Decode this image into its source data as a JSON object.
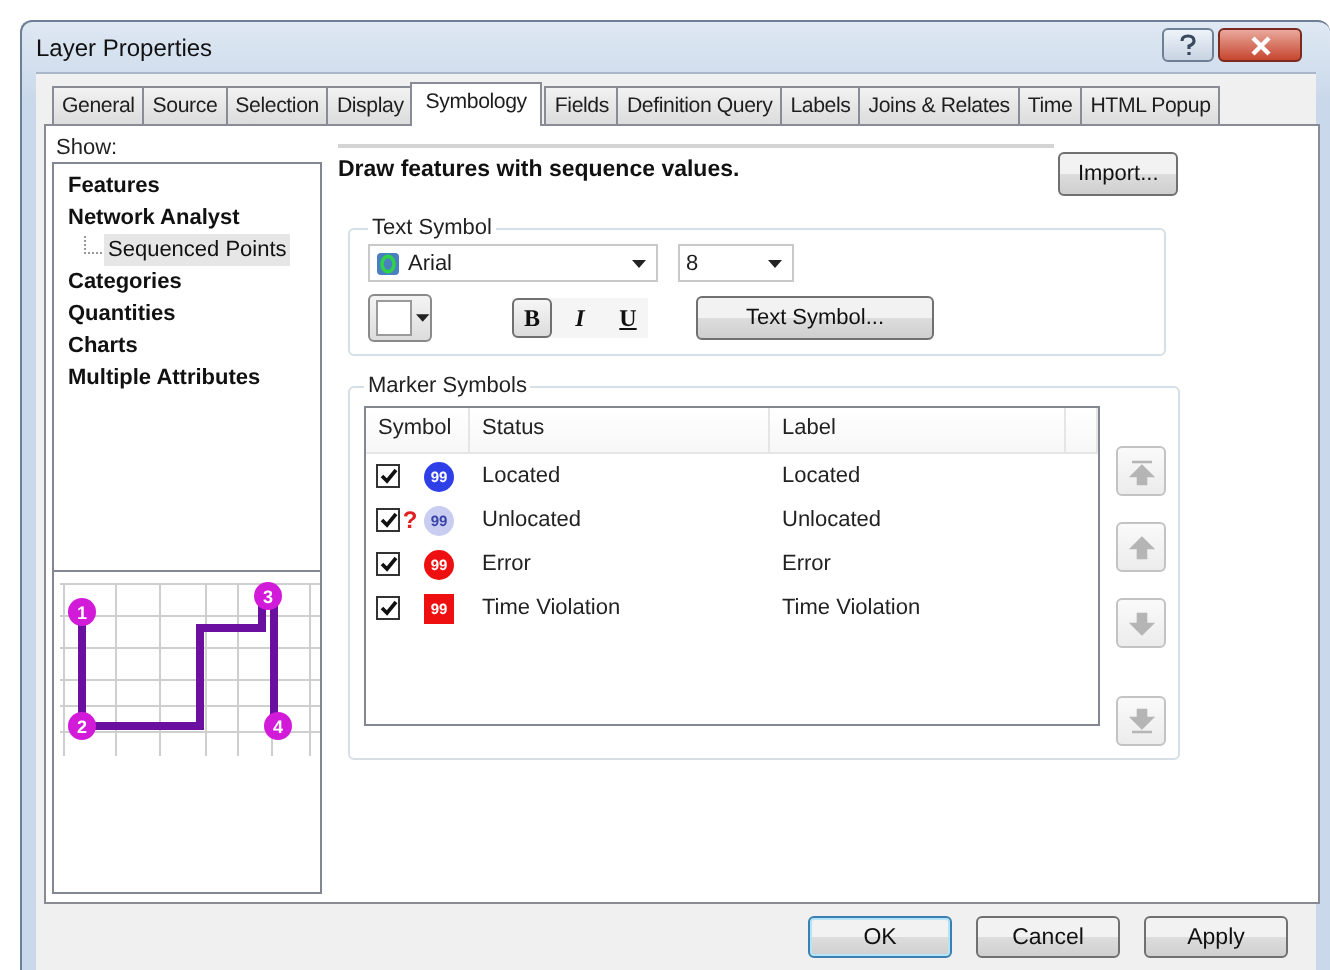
{
  "window": {
    "title": "Layer Properties"
  },
  "tabs": [
    {
      "label": "General",
      "selected": false
    },
    {
      "label": "Source",
      "selected": false
    },
    {
      "label": "Selection",
      "selected": false
    },
    {
      "label": "Display",
      "selected": false
    },
    {
      "label": "Symbology",
      "selected": true
    },
    {
      "label": "Fields",
      "selected": false
    },
    {
      "label": "Definition Query",
      "selected": false
    },
    {
      "label": "Labels",
      "selected": false
    },
    {
      "label": "Joins & Relates",
      "selected": false
    },
    {
      "label": "Time",
      "selected": false
    },
    {
      "label": "HTML Popup",
      "selected": false
    }
  ],
  "show": {
    "label": "Show:",
    "items": [
      {
        "label": "Features",
        "selected": false
      },
      {
        "label": "Network Analyst",
        "selected": false,
        "children": [
          {
            "label": "Sequenced Points",
            "selected": true
          }
        ]
      },
      {
        "label": "Categories",
        "selected": false
      },
      {
        "label": "Quantities",
        "selected": false
      },
      {
        "label": "Charts",
        "selected": false
      },
      {
        "label": "Multiple Attributes",
        "selected": false
      }
    ]
  },
  "preview": {
    "points": [
      "1",
      "2",
      "3",
      "4"
    ]
  },
  "description": "Draw features with sequence values.",
  "import_button": "Import...",
  "text_symbol": {
    "title": "Text Symbol",
    "font": "Arial",
    "size": "8",
    "color": "#ffffff",
    "styles": [
      {
        "label": "B",
        "kind": "bold",
        "selected": true
      },
      {
        "label": "I",
        "kind": "italic",
        "selected": false
      },
      {
        "label": "U",
        "kind": "underline",
        "selected": false
      }
    ],
    "button": "Text Symbol..."
  },
  "marker_symbols": {
    "title": "Marker Symbols",
    "columns": [
      "Symbol",
      "Status",
      "Label"
    ],
    "rows": [
      {
        "checked": true,
        "kind": "circle",
        "color": "#2f3fe8",
        "symbol_text": "99",
        "status": "Located",
        "label": "Located"
      },
      {
        "checked": true,
        "kind": "unlocated",
        "color": "#c9cdf2",
        "symbol_text": "99",
        "marker": "?",
        "status": "Unlocated",
        "label": "Unlocated"
      },
      {
        "checked": true,
        "kind": "circle",
        "color": "#ee1010",
        "symbol_text": "99",
        "status": "Error",
        "label": "Error"
      },
      {
        "checked": true,
        "kind": "square",
        "color": "#ee1010",
        "symbol_text": "99",
        "status": "Time Violation",
        "label": "Time Violation"
      }
    ],
    "move_buttons": [
      {
        "kind": "top",
        "disabled": true
      },
      {
        "kind": "up",
        "disabled": true
      },
      {
        "kind": "down",
        "disabled": true
      },
      {
        "kind": "bottom",
        "disabled": true
      }
    ]
  },
  "buttons": [
    {
      "label": "OK",
      "kind": "default"
    },
    {
      "label": "Cancel",
      "kind": "normal"
    },
    {
      "label": "Apply",
      "kind": "normal"
    }
  ]
}
